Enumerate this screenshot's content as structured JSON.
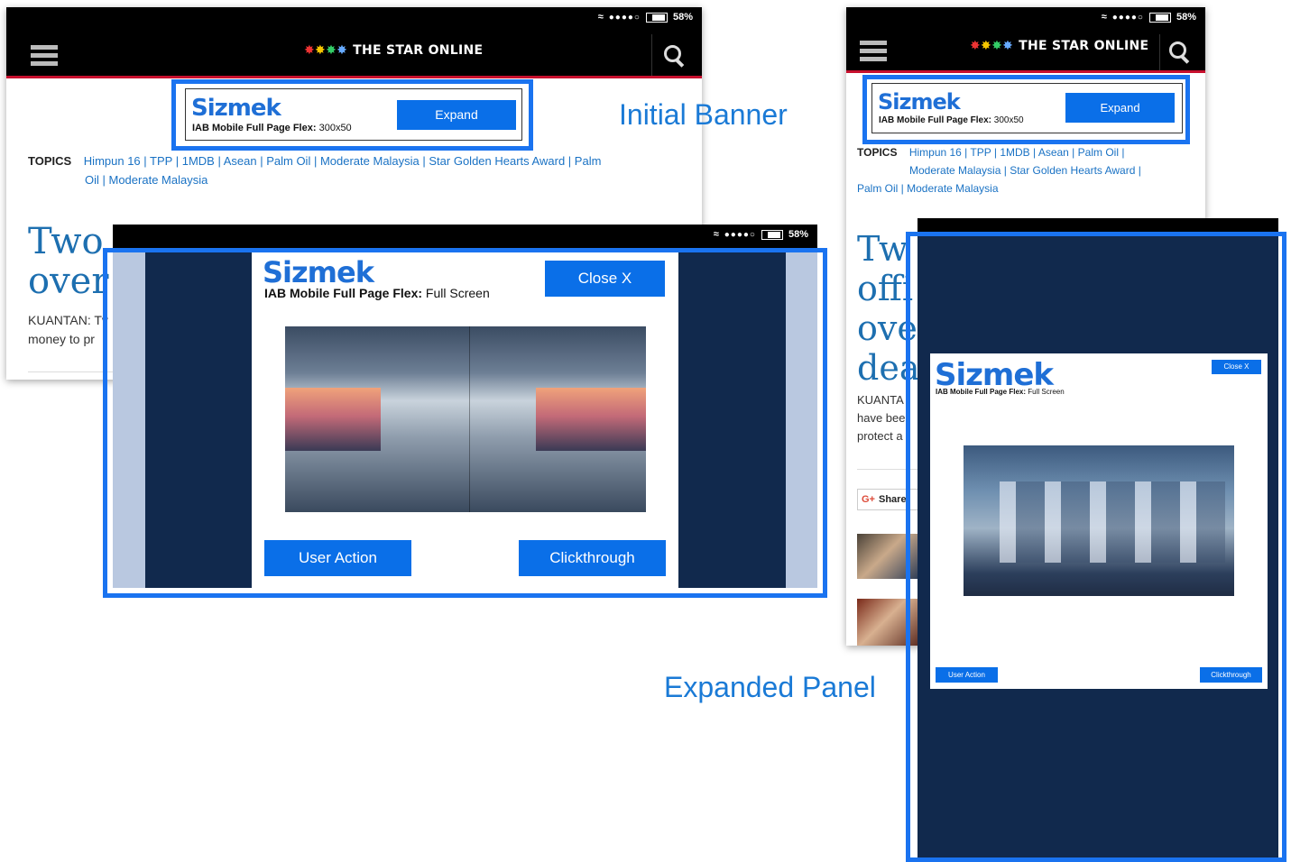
{
  "status_bar": {
    "signal": "●●●●○",
    "battery": "58%"
  },
  "site": {
    "title": "THE STAR ONLINE"
  },
  "banner": {
    "brand": "Sizmek",
    "format_bold": "IAB Mobile Full Page Flex:",
    "format_rest": " 300x50",
    "button": "Expand"
  },
  "topics": {
    "label": "TOPICS",
    "items": [
      "Himpun 16",
      "TPP",
      "1MDB",
      "Asean",
      "Palm Oil",
      "Moderate Malaysia",
      "Star Golden Hearts Award",
      "Palm Oil",
      "Moderate Malaysia"
    ]
  },
  "article_left": {
    "headline_1": "Two",
    "headline_2": "over",
    "body_1": "KUANTAN: Tv",
    "body_2": "money to pr"
  },
  "article_right": {
    "headline_1": "Tw",
    "headline_2": "offi",
    "headline_3": "ove",
    "headline_4": "dea",
    "body_1": "KUANTA",
    "body_2": "have bee",
    "body_3": "protect a",
    "share": "Share"
  },
  "expanded": {
    "brand": "Sizmek",
    "format_bold": "IAB Mobile Full Page Flex:",
    "format_rest": " Full Screen",
    "close": "Close X",
    "user_action": "User Action",
    "clickthrough": "Clickthrough"
  },
  "callouts": {
    "initial": "Initial Banner",
    "expanded": "Expanded Panel"
  },
  "colors": {
    "accent": "#1a73f0",
    "button": "#0a6fe8",
    "navy": "#11294d",
    "link": "#1a72c4"
  }
}
